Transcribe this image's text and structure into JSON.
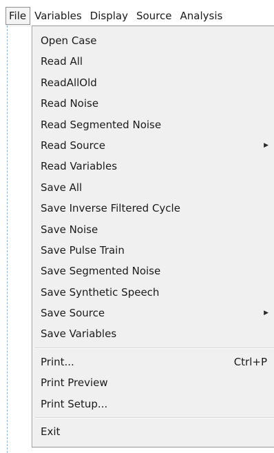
{
  "menubar": {
    "items": [
      {
        "label": "File"
      },
      {
        "label": "Variables"
      },
      {
        "label": "Display"
      },
      {
        "label": "Source"
      },
      {
        "label": "Analysis"
      }
    ],
    "active": "File"
  },
  "file_menu": {
    "group1": [
      {
        "label": "Open Case"
      },
      {
        "label": "Read All"
      },
      {
        "label": "ReadAllOld"
      },
      {
        "label": "Read Noise"
      },
      {
        "label": "Read Segmented Noise"
      },
      {
        "label": "Read Source",
        "submenu_icon": "chevron-right-icon"
      },
      {
        "label": "Read Variables"
      },
      {
        "label": "Save All"
      },
      {
        "label": "Save Inverse Filtered Cycle"
      },
      {
        "label": "Save Noise"
      },
      {
        "label": "Save Pulse Train"
      },
      {
        "label": "Save Segmented Noise"
      },
      {
        "label": "Save Synthetic Speech"
      },
      {
        "label": "Save Source",
        "submenu_icon": "chevron-right-icon"
      },
      {
        "label": "Save Variables"
      }
    ],
    "group2": [
      {
        "label": "Print...",
        "shortcut": "Ctrl+P"
      },
      {
        "label": "Print Preview"
      },
      {
        "label": "Print Setup..."
      }
    ],
    "group3": [
      {
        "label": "Exit"
      }
    ]
  },
  "colors": {
    "menu_background": "#f0f0f0",
    "menu_border": "#979797",
    "active_border": "#8e8f8f",
    "window_edge": "#8fb3d9"
  }
}
